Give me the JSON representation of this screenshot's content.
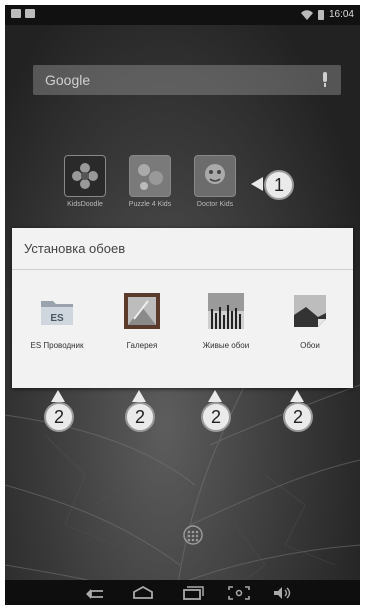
{
  "statusbar": {
    "time": "16:04"
  },
  "search": {
    "logo": "Google"
  },
  "apps": [
    {
      "label": "KidsDoodle"
    },
    {
      "label": "Puzzle 4 Kids"
    },
    {
      "label": "Doctor Kids"
    }
  ],
  "dialog": {
    "title": "Установка обоев",
    "options": [
      {
        "label": "ES Проводник",
        "icon": "es-explorer-icon"
      },
      {
        "label": "Галерея",
        "icon": "gallery-icon"
      },
      {
        "label": "Живые обои",
        "icon": "live-wallpaper-icon"
      },
      {
        "label": "Обои",
        "icon": "wallpaper-icon"
      }
    ]
  },
  "callouts": {
    "one": "1",
    "two": "2"
  },
  "navbar": {
    "icons": [
      "back-icon",
      "home-icon",
      "recents-icon",
      "screenshot-icon",
      "volume-icon"
    ]
  },
  "colors": {
    "dialog_bg": "#f2f2f2",
    "screen_bg": "#2a2a2a"
  }
}
